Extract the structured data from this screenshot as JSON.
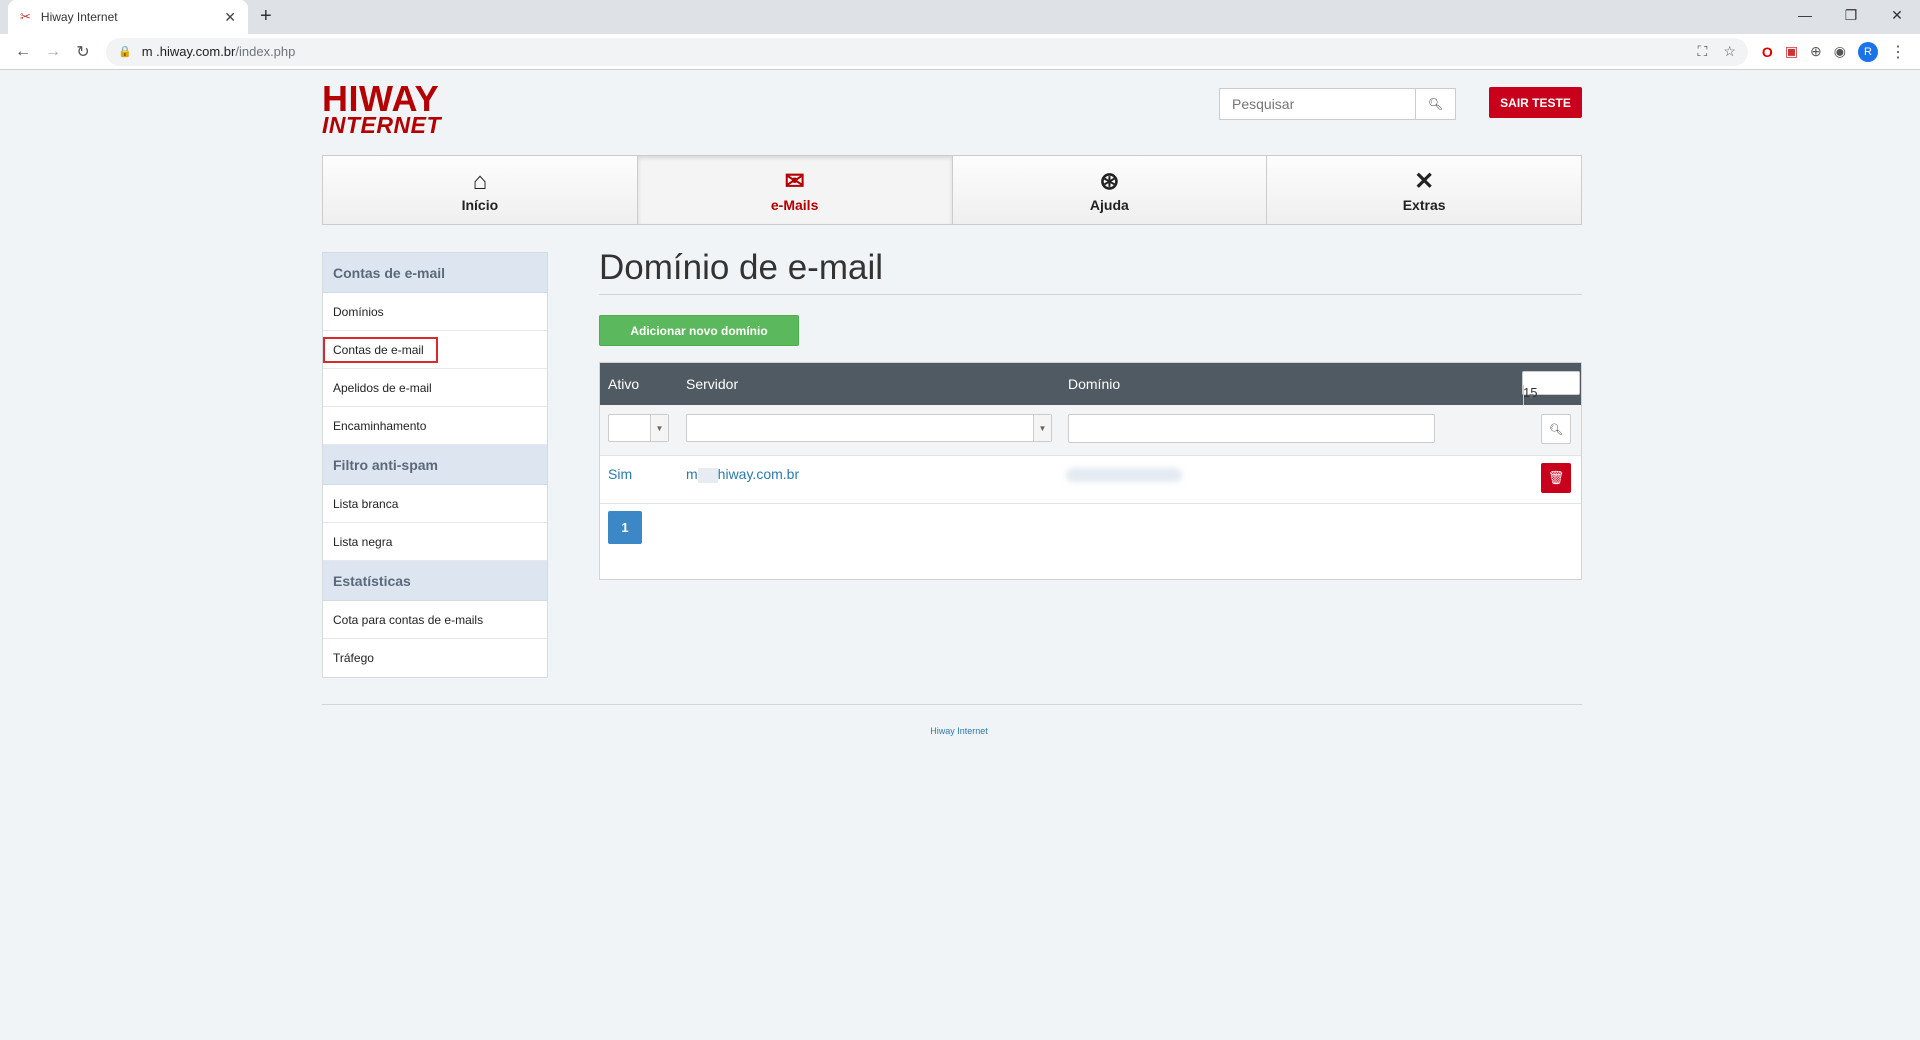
{
  "browser": {
    "tab_title": "Hiway Internet",
    "url_host": "m   .hiway.com.br",
    "url_path": "/index.php",
    "profile_initial": "R"
  },
  "logo": {
    "line1": "HIWAY",
    "line2": "INTERNET"
  },
  "header": {
    "search_placeholder": "Pesquisar",
    "logout_label": "SAIR TESTE"
  },
  "nav": {
    "items": [
      {
        "label": "Início",
        "icon": "home-icon"
      },
      {
        "label": "e-Mails",
        "icon": "envelope-at-icon"
      },
      {
        "label": "Ajuda",
        "icon": "lifebuoy-icon"
      },
      {
        "label": "Extras",
        "icon": "tools-icon"
      }
    ],
    "active_index": 1
  },
  "sidebar": {
    "sections": [
      {
        "title": "Contas de e-mail",
        "items": [
          "Domínios",
          "Contas de e-mail",
          "Apelidos de e-mail",
          "Encaminhamento"
        ]
      },
      {
        "title": "Filtro anti-spam",
        "items": [
          "Lista branca",
          "Lista negra"
        ]
      },
      {
        "title": "Estatísticas",
        "items": [
          "Cota para contas de e-mails",
          "Tráfego"
        ]
      }
    ],
    "selected": "Contas de e-mail"
  },
  "main": {
    "title": "Domínio de e-mail",
    "add_button": "Adicionar novo domínio",
    "table": {
      "columns": [
        "Ativo",
        "Servidor",
        "Domínio"
      ],
      "page_size": "15",
      "rows": [
        {
          "ativo": "Sim",
          "servidor_prefix": "m",
          "servidor_suffix": "hiway.com.br"
        }
      ],
      "current_page": "1"
    }
  },
  "footer": {
    "text": "Hiway Internet"
  },
  "colors": {
    "brand_red": "#b30000",
    "button_red": "#c8001c",
    "green": "#5cb85c",
    "link": "#2a7ab0",
    "grid_header": "#505a63"
  }
}
